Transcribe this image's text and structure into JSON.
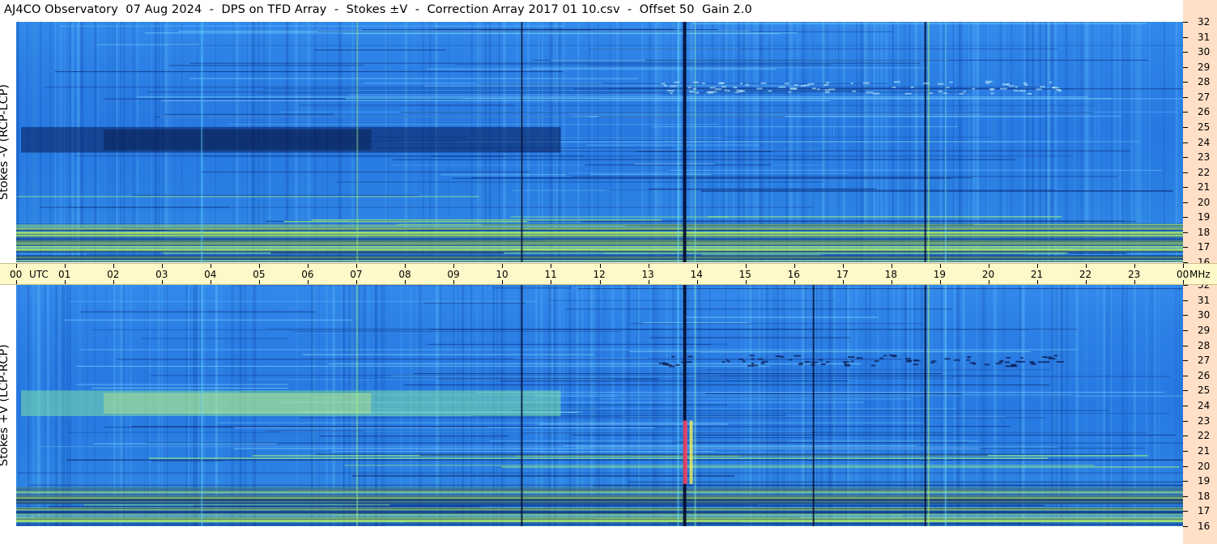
{
  "title": "AJ4CO Observatory  07 Aug 2024  -  DPS on TFD Array  -  Stokes ±V  -  Correction Array 2017 01 10.csv  -  Offset 50  Gain 2.0",
  "chart_data": [
    {
      "type": "heatmap",
      "name": "Stokes -V (RCP-LCP)",
      "ylabel": "Stokes -V (RCP-LCP)",
      "x_unit": "UTC",
      "xlim": [
        "00",
        "00"
      ],
      "y_unit": "MHz",
      "ylim": [
        16,
        32
      ],
      "y_ticks": [
        "16",
        "17",
        "18",
        "19",
        "20",
        "21",
        "22",
        "23",
        "24",
        "25",
        "26",
        "27",
        "28",
        "29",
        "30",
        "31",
        "32"
      ],
      "dark_band_hours": [
        0.1,
        11.2
      ],
      "dark_band_mhz": [
        23.3,
        25.0
      ],
      "vertical_lines_utc": [
        10.4,
        13.75,
        18.7
      ]
    },
    {
      "type": "heatmap",
      "name": "Stokes +V (LCP-RCP)",
      "ylabel": "Stokes +V (LCP-RCP)",
      "x_unit": "UTC",
      "xlim": [
        "00",
        "00"
      ],
      "y_unit": "MHz",
      "ylim": [
        16,
        32
      ],
      "y_ticks": [
        "16",
        "17",
        "18",
        "19",
        "20",
        "21",
        "22",
        "23",
        "24",
        "25",
        "26",
        "27",
        "28",
        "29",
        "30",
        "31",
        "32"
      ],
      "bright_band_hours": [
        0.1,
        11.2
      ],
      "bright_band_mhz": [
        23.3,
        25.0
      ],
      "vertical_lines_utc": [
        10.4,
        13.75,
        16.4,
        18.7
      ]
    }
  ],
  "time_axis": {
    "labels": [
      "00",
      "01",
      "02",
      "03",
      "04",
      "05",
      "06",
      "07",
      "08",
      "09",
      "10",
      "11",
      "12",
      "13",
      "14",
      "15",
      "16",
      "17",
      "18",
      "19",
      "20",
      "21",
      "22",
      "23",
      "00"
    ],
    "utc_label": "UTC",
    "mhz_label": "MHz"
  },
  "colors": {
    "base": "#2a7fe6",
    "dark": "#061a55",
    "bright": "#7be0a8",
    "time_axis_bg": "#fff8c8",
    "freq_axis_bg": "#ffdfc6"
  }
}
